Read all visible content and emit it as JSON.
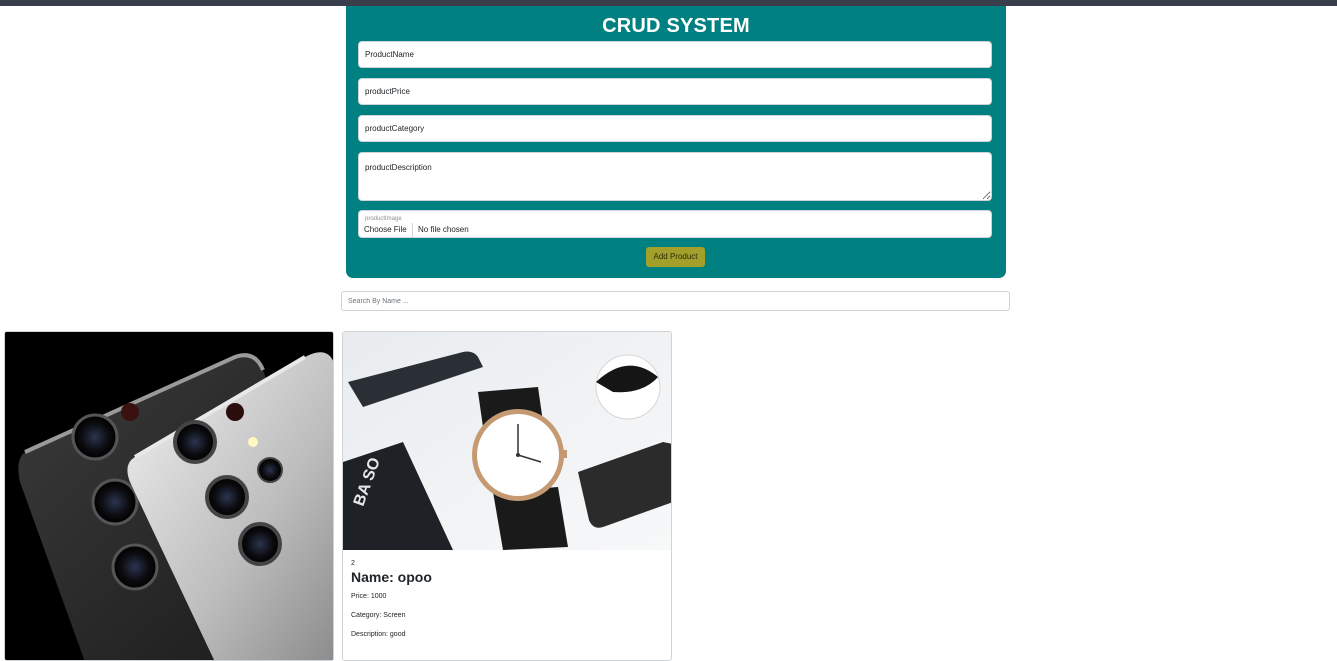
{
  "form": {
    "title": "CRUD SYSTEM",
    "name_placeholder": "ProductName",
    "price_placeholder": "productPrice",
    "category_placeholder": "productCategory",
    "description_placeholder": "productDescription",
    "image_label": "productImage",
    "choose_file_label": "Choose File",
    "no_file_text": "No file chosen",
    "add_button_label": "Add Product"
  },
  "search": {
    "placeholder": "Search By Name ..."
  },
  "products": [
    {
      "image_icon": "phone-cameras-photo"
    },
    {
      "image_icon": "watch-photo",
      "id": "2",
      "name": "Name: opoo",
      "price": "Price: 1000",
      "category": "Category: Screen",
      "description": "Description: good"
    }
  ],
  "colors": {
    "panel": "#008080",
    "button": "#a2a02a",
    "topbar": "#3a3d4a"
  }
}
